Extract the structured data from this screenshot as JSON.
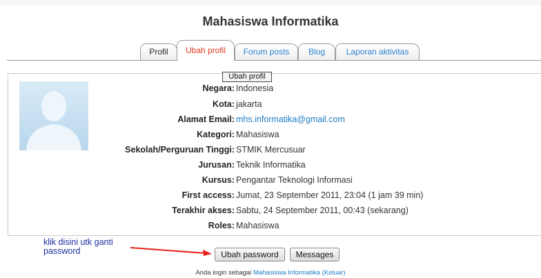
{
  "page_title": "Mahasiswa Informatika",
  "tabs": [
    {
      "label": "Profil"
    },
    {
      "label": "Ubah profil"
    },
    {
      "label": "Forum posts"
    },
    {
      "label": "Blog"
    },
    {
      "label": "Laporan aktivitas"
    }
  ],
  "active_tab": "Ubah profil",
  "tooltip": "Ubah profil",
  "profile": [
    {
      "label": "Negara:",
      "value": "Indonesia"
    },
    {
      "label": "Kota:",
      "value": "jakarta"
    },
    {
      "label": "Alamat Email:",
      "value": "mhs.informatika@gmail.com"
    },
    {
      "label": "Kategori:",
      "value": "Mahasiswa"
    },
    {
      "label": "Sekolah/Perguruan Tinggi:",
      "value": "STMIK Mercusuar"
    },
    {
      "label": "Jurusan:",
      "value": "Teknik Informatika"
    },
    {
      "label": "Kursus:",
      "value": "Pengantar Teknologi Informasi"
    },
    {
      "label": "First access:",
      "value": "Jumat, 23 September 2011, 23:04  (1 jam 39 min)"
    },
    {
      "label": "Terakhir akses:",
      "value": "Sabtu, 24 September 2011, 00:43  (sekarang)"
    },
    {
      "label": "Roles:",
      "value": "Mahasiswa"
    }
  ],
  "annotation": {
    "line1": "klik disini utk ganti",
    "line2": "password"
  },
  "buttons": {
    "change_password": "Ubah password",
    "messages": "Messages"
  },
  "footer": {
    "prefix": "Anda login sebagai",
    "user": "Mahasiswa Informatika",
    "logout": "(Keluar)"
  },
  "colors": {
    "link": "#1a7cc4",
    "active_tab": "#e23a1d",
    "annotation": "#1b2da0",
    "arrow": "#e8201a"
  }
}
